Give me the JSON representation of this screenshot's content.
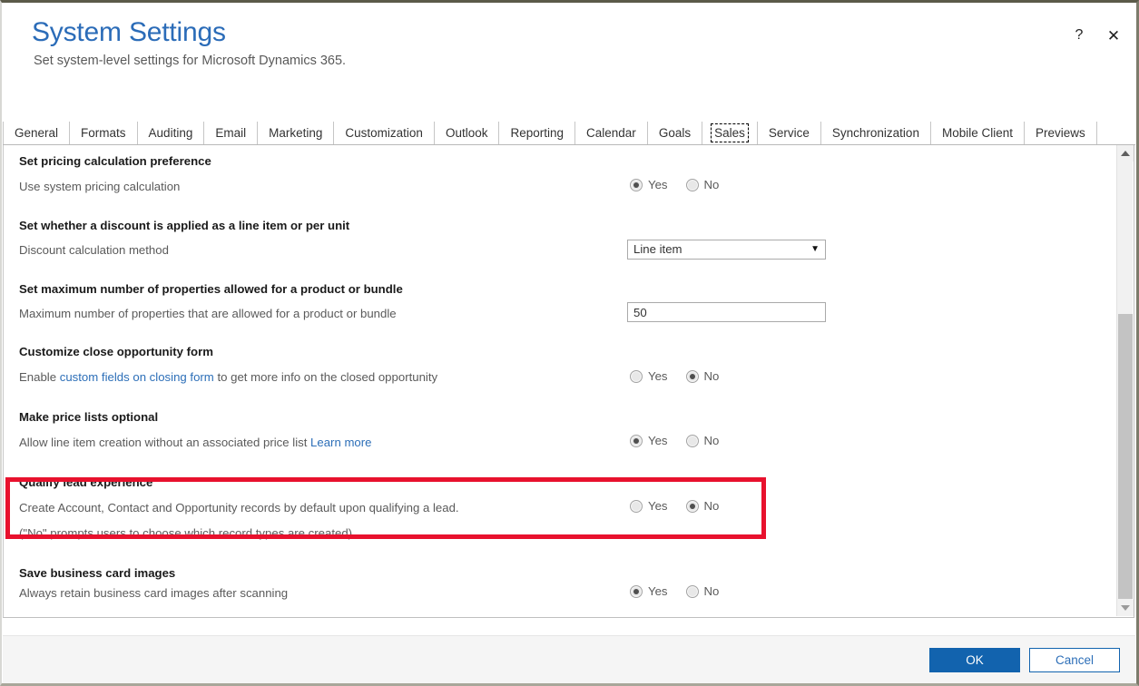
{
  "window": {
    "title": "System Settings",
    "subtitle": "Set system-level settings for Microsoft Dynamics 365.",
    "help_icon": "?",
    "close_icon": "✕",
    "accent_color": "#2b6cb8",
    "primary_button_color": "#1263ae",
    "highlight_color": "#e8112d"
  },
  "tabs": [
    {
      "label": "General",
      "focused": false
    },
    {
      "label": "Formats",
      "focused": false
    },
    {
      "label": "Auditing",
      "focused": false
    },
    {
      "label": "Email",
      "focused": false
    },
    {
      "label": "Marketing",
      "focused": false
    },
    {
      "label": "Customization",
      "focused": false
    },
    {
      "label": "Outlook",
      "focused": false
    },
    {
      "label": "Reporting",
      "focused": false
    },
    {
      "label": "Calendar",
      "focused": false
    },
    {
      "label": "Goals",
      "focused": false
    },
    {
      "label": "Sales",
      "focused": true
    },
    {
      "label": "Service",
      "focused": false
    },
    {
      "label": "Synchronization",
      "focused": false
    },
    {
      "label": "Mobile Client",
      "focused": false
    },
    {
      "label": "Previews",
      "focused": false
    }
  ],
  "sections": {
    "pricing": {
      "title": "Set pricing calculation preference",
      "desc": "Use system pricing calculation",
      "yes_label": "Yes",
      "no_label": "No",
      "selected": "Yes"
    },
    "discount": {
      "title": "Set whether a discount is applied as a line item or per unit",
      "desc": "Discount calculation method",
      "value": "Line item",
      "arrow": "▼"
    },
    "max_properties": {
      "title": "Set maximum number of properties allowed for a product or bundle",
      "desc": "Maximum number of properties that are allowed for a product or bundle",
      "value": "50"
    },
    "close_opportunity": {
      "title": "Customize close opportunity form",
      "desc_pre": "Enable ",
      "desc_link": "custom fields on closing form",
      "desc_post": " to get more info on the closed opportunity",
      "yes_label": "Yes",
      "no_label": "No",
      "selected": "No"
    },
    "price_lists": {
      "title": "Make price lists optional",
      "desc_pre": "Allow line item creation without an associated price list ",
      "desc_link": "Learn more",
      "yes_label": "Yes",
      "no_label": "No",
      "selected": "Yes"
    },
    "qualify_lead": {
      "title": "Qualify lead experience",
      "desc": "Create Account, Contact and Opportunity records by default upon qualifying a lead.",
      "desc2": "(\"No\" prompts users to choose which record types are created)",
      "yes_label": "Yes",
      "no_label": "No",
      "selected": "No"
    },
    "business_card": {
      "title": "Save business card images",
      "desc": "Always retain business card images after scanning",
      "yes_label": "Yes",
      "no_label": "No",
      "selected": "Yes"
    }
  },
  "footer": {
    "ok_label": "OK",
    "cancel_label": "Cancel"
  },
  "scrollbar": {
    "up_arrow": "▲",
    "down_arrow": "▼"
  }
}
